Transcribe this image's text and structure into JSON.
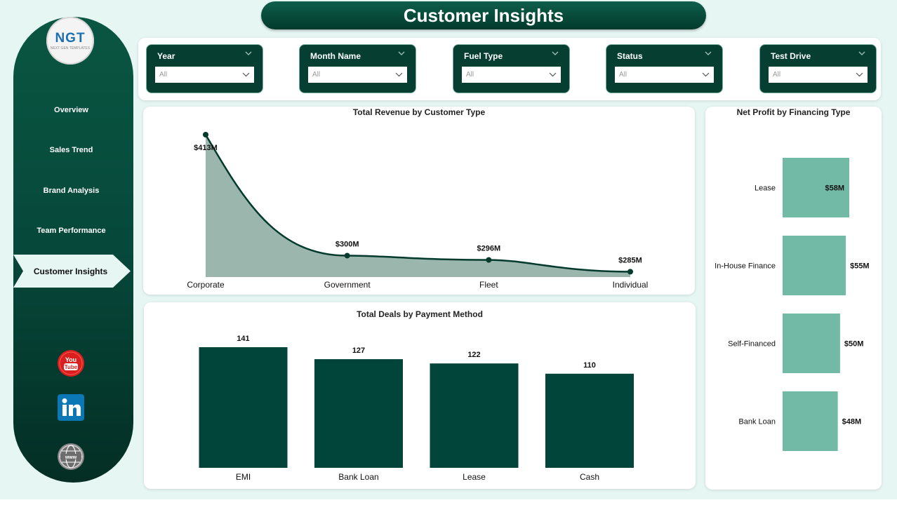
{
  "title": "Customer Insights",
  "logo": {
    "main": "NGT",
    "sub": "NEXT GEN TEMPLATES"
  },
  "nav": {
    "items": [
      "Overview",
      "Sales Trend",
      "Brand Analysis",
      "Team Performance",
      "Customer Insights"
    ],
    "active": "Customer Insights"
  },
  "social": [
    "youtube-icon",
    "linkedin-icon",
    "web-icon"
  ],
  "filters": [
    {
      "label": "Year",
      "value": "All"
    },
    {
      "label": "Month Name",
      "value": "All"
    },
    {
      "label": "Fuel Type",
      "value": "All"
    },
    {
      "label": "Status",
      "value": "All"
    },
    {
      "label": "Test Drive",
      "value": "All"
    }
  ],
  "colors": {
    "accent": "#023a2c",
    "area": "#9bb6ac",
    "hbar": "#72b9a6",
    "bar": "#01443a"
  },
  "chart_data": [
    {
      "type": "area",
      "title": "Total Revenue by Customer Type",
      "categories": [
        "Corporate",
        "Government",
        "Fleet",
        "Individual"
      ],
      "values": [
        413,
        300,
        296,
        285
      ],
      "labels": [
        "$413M",
        "$300M",
        "$296M",
        "$285M"
      ]
    },
    {
      "type": "bar",
      "title": "Total Deals by Payment Method",
      "categories": [
        "EMI",
        "Bank Loan",
        "Lease",
        "Cash"
      ],
      "values": [
        141,
        127,
        122,
        110
      ],
      "ylim": [
        0,
        141
      ]
    },
    {
      "type": "bar",
      "orientation": "horizontal",
      "title": "Net Profit by Financing Type",
      "categories": [
        "Lease",
        "In-House Finance",
        "Self-Financed",
        "Bank Loan"
      ],
      "values": [
        58,
        55,
        50,
        48
      ],
      "labels": [
        "$58M",
        "$55M",
        "$50M",
        "$48M"
      ]
    }
  ]
}
